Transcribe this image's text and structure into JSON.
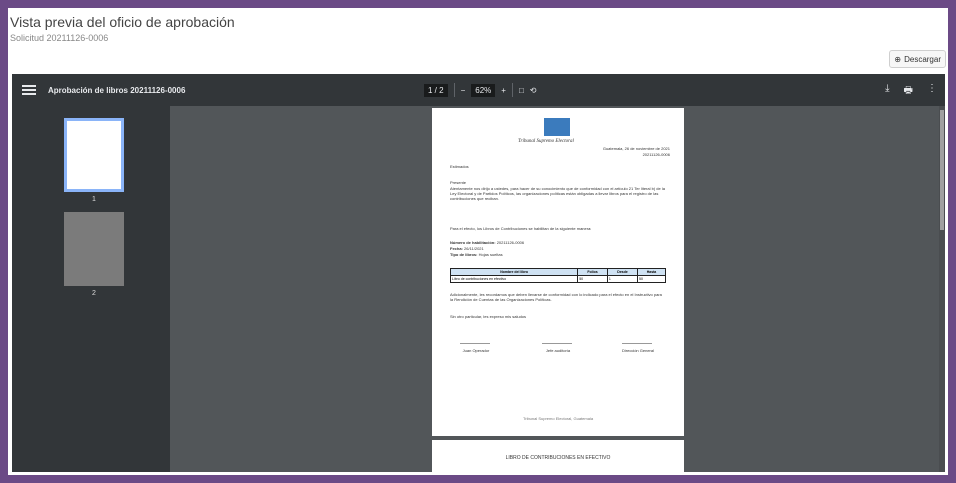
{
  "header": {
    "title": "Vista previa del oficio de aprobación",
    "subtitle": "Solicitud 20211126-0006"
  },
  "actions": {
    "download_label": "Descargar"
  },
  "viewer": {
    "doc_title": "Aprobación de libros 20211126-0006",
    "page_indicator": "1 / 2",
    "zoom": "62%",
    "thumb_labels": [
      "1",
      "2"
    ]
  },
  "document": {
    "institution": "Tribunal Supremo Electoral",
    "place_date": "Guatemala, 26 de noviembre de 2021",
    "ref": "20211126-0006",
    "greeting": "Estimados",
    "salutation": "Presente",
    "paragraph1": "Atentamente nos dirijo a ustedes, para hacer de su conocimiento que de conformidad con el artículo 21 Ter literal b) de la Ley Electoral y de Partidos Políticos, las organizaciones políticas están obligadas a llevar libros para el registro de las contribuciones que reciban.",
    "paragraph2": "Para el efecto, los Libros de Contribuciones se habilitan de la siguiente manera:",
    "request_number_label": "Número de habilitación:",
    "request_number": "20211126-0006",
    "date_label": "Fecha:",
    "date_value": "26/11/2021",
    "book_type_label": "Tipo de libros:",
    "book_type_value": "Hojas sueltas",
    "table_headers": [
      "Nombre del libro",
      "Folios",
      "Desde",
      "Hasta"
    ],
    "table_rows": [
      [
        "Libro de contribuciones en efectivo",
        "50",
        "1",
        "50"
      ]
    ],
    "paragraph3": "Adicionalmente, les recordamos que deben llevarse de conformidad con lo indicado para el efecto en el Instructivo para la Rendición de Cuentas de las Organizaciones Políticas.",
    "closing": "Sin otro particular, les expreso mis saludos",
    "signers": [
      "Juan Operador",
      "Jefe auditoría",
      "Dirección General"
    ],
    "footer": "Tribunal Supremo Electoral, Guatemala",
    "page2_title": "LIBRO DE CONTRIBUCIONES EN EFECTIVO"
  }
}
